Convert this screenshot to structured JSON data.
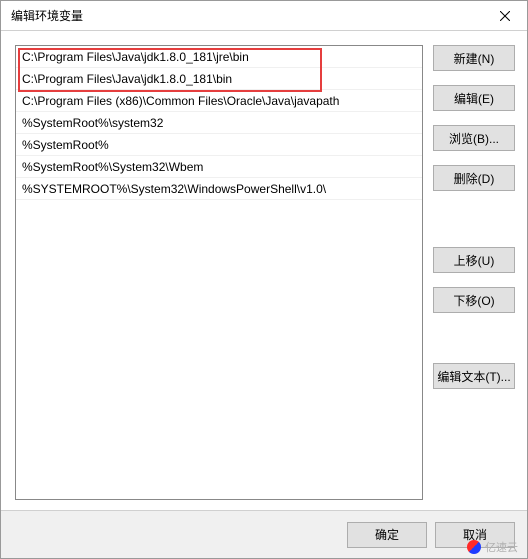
{
  "window": {
    "title": "编辑环境变量"
  },
  "list": {
    "items": [
      "C:\\Program Files\\Java\\jdk1.8.0_181\\jre\\bin",
      "C:\\Program Files\\Java\\jdk1.8.0_181\\bin",
      "C:\\Program Files (x86)\\Common Files\\Oracle\\Java\\javapath",
      "%SystemRoot%\\system32",
      "%SystemRoot%",
      "%SystemRoot%\\System32\\Wbem",
      "%SYSTEMROOT%\\System32\\WindowsPowerShell\\v1.0\\"
    ]
  },
  "buttons": {
    "new": "新建(N)",
    "edit": "编辑(E)",
    "browse": "浏览(B)...",
    "delete": "删除(D)",
    "moveup": "上移(U)",
    "movedown": "下移(O)",
    "edittext": "编辑文本(T)..."
  },
  "footer": {
    "ok": "确定",
    "cancel": "取消"
  },
  "watermark": {
    "text": "亿速云"
  }
}
